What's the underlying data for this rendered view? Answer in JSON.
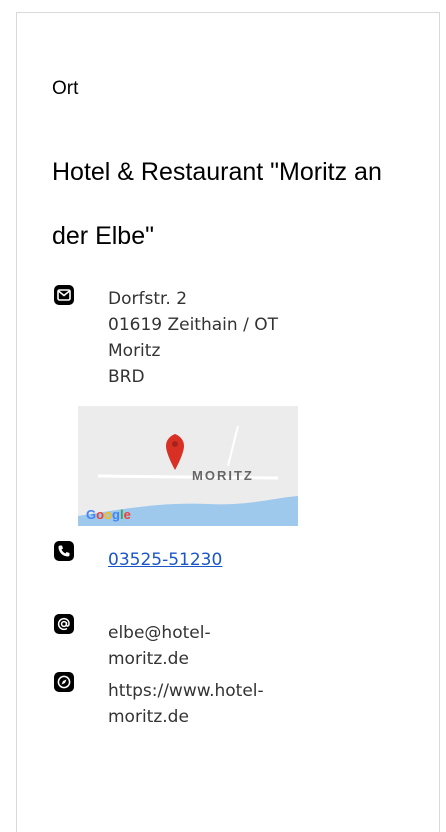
{
  "location": {
    "section_label": "Ort",
    "hotel_name": "Hotel & Restaurant \"Moritz an der Elbe\"",
    "address": {
      "icon": "envelope-icon",
      "lines": [
        "Dorfstr. 2",
        "01619 Zeithain / OT",
        "Moritz",
        "BRD"
      ]
    },
    "map": {
      "place_label": "MORITZ",
      "provider": "Google",
      "pin_color": "#d93025",
      "water_color": "#9ec9ed"
    },
    "phone": {
      "icon": "phone-icon",
      "number": "03525-51230"
    },
    "email": {
      "icon": "at-sign-icon",
      "lines": [
        "elbe@hotel-",
        "moritz.de"
      ]
    },
    "website": {
      "icon": "compass-icon",
      "lines": [
        "https://www.hotel-",
        "moritz.de"
      ]
    },
    "colors": {
      "link": "#1a56c8",
      "icon_bg": "#000000",
      "border": "#d9d9d9"
    }
  }
}
